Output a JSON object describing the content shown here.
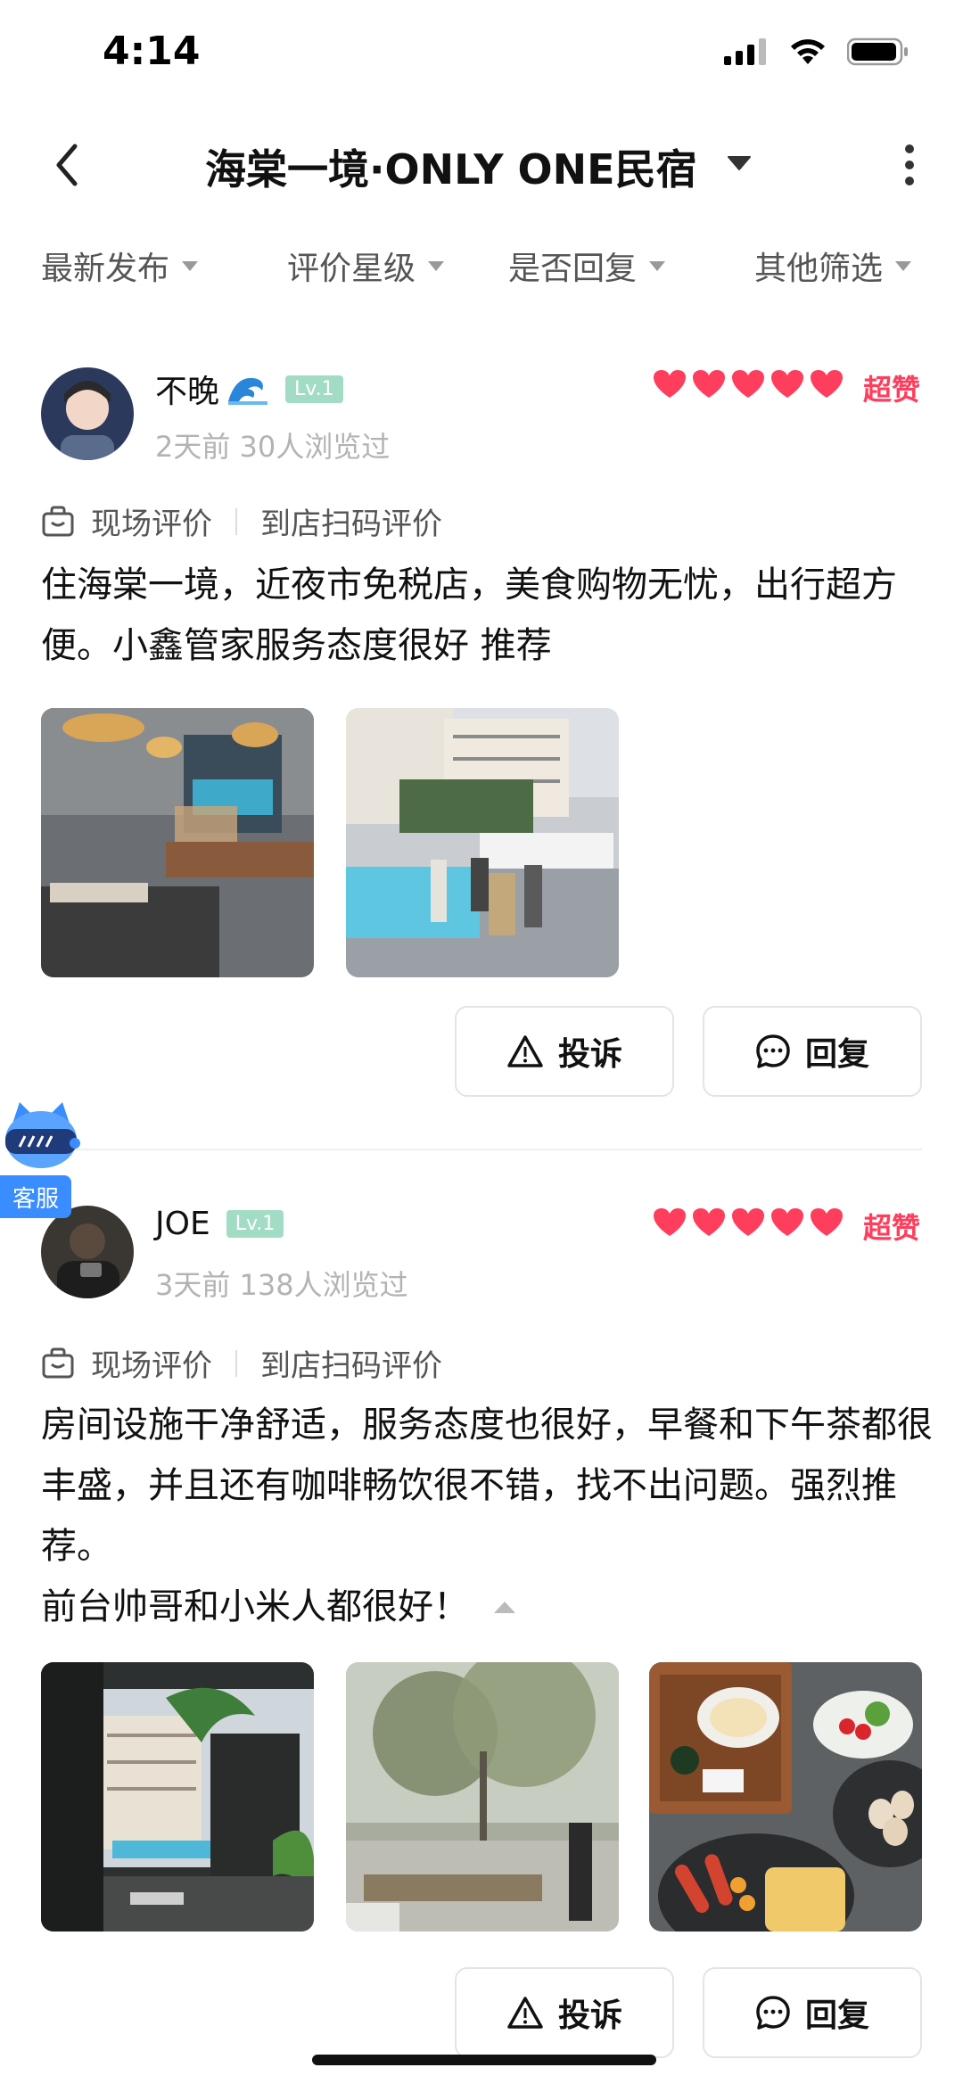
{
  "status": {
    "time": "4:14"
  },
  "nav": {
    "title": "海棠一境·ONLY ONE民宿"
  },
  "filters": [
    {
      "label": "最新发布"
    },
    {
      "label": "评价星级"
    },
    {
      "label": "是否回复"
    },
    {
      "label": "其他筛选"
    }
  ],
  "reviews": [
    {
      "username": "不晚",
      "level": "Lv.1",
      "meta": "2天前 30人浏览过",
      "rating_hearts": 5,
      "rating_label": "超赞",
      "eval_type": "现场评价",
      "eval_method": "到店扫码评价",
      "text": "住海棠一境，近夜市免税店，美食购物无忧，出行超方便。小鑫管家服务态度很好 推荐",
      "photo_count": 2,
      "actions": {
        "complain": "投诉",
        "reply": "回复"
      }
    },
    {
      "username": "JOE",
      "level": "Lv.1",
      "meta": "3天前 138人浏览过",
      "rating_hearts": 5,
      "rating_label": "超赞",
      "eval_type": "现场评价",
      "eval_method": "到店扫码评价",
      "text": "房间设施干净舒适，服务态度也很好，早餐和下午茶都很丰盛，并且还有咖啡畅饮很不错，找不出问题。强烈推荐。",
      "text_line2": "前台帅哥和小米人都很好！",
      "photo_count": 3,
      "actions": {
        "complain": "投诉",
        "reply": "回复"
      }
    }
  ],
  "service": {
    "label": "客服"
  },
  "colors": {
    "accent": "#ff3d5c",
    "level_badge": "#a3dcc4",
    "service": "#3a8dff"
  }
}
